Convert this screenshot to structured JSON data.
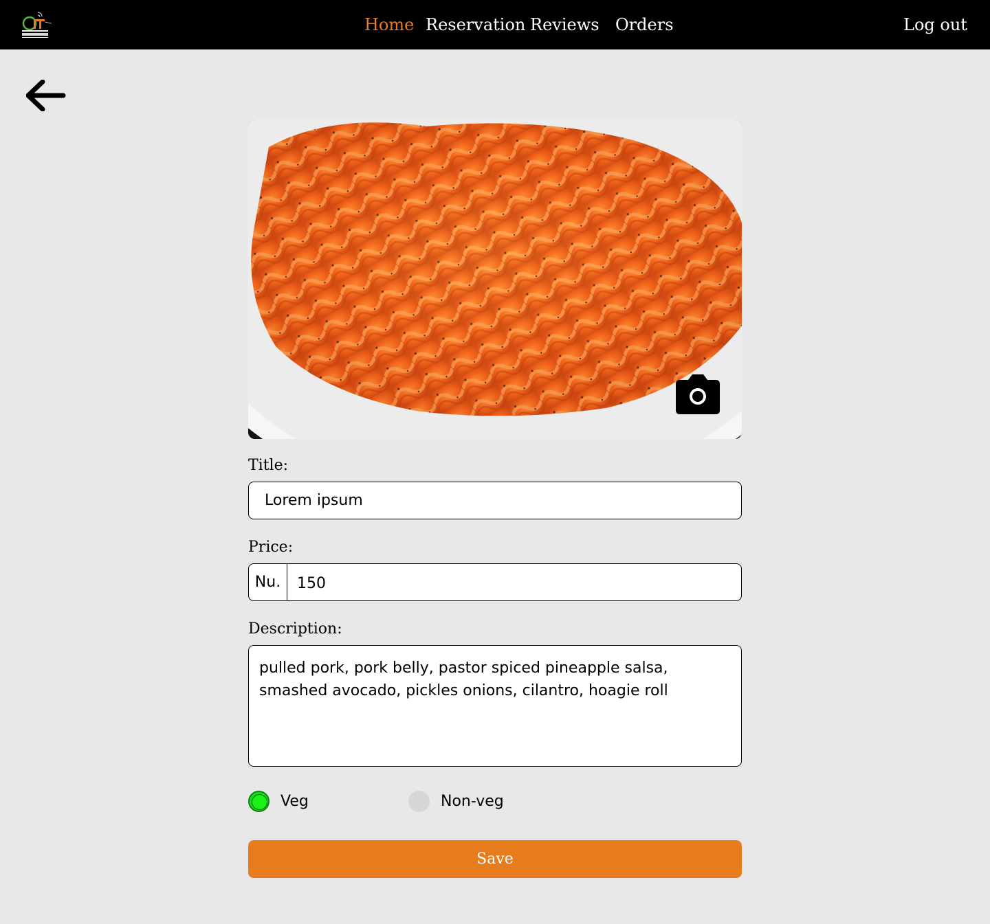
{
  "header": {
    "logo_alt": "CiT GYALPOZHING",
    "nav": [
      {
        "label": "Home",
        "active": true
      },
      {
        "label": "Reservation",
        "active": false
      },
      {
        "label": "Reviews",
        "active": false
      },
      {
        "label": "Orders",
        "active": false
      }
    ],
    "logout_label": "Log out"
  },
  "colors": {
    "accent": "#e67c24",
    "header_bg": "#000000",
    "page_bg": "#e8e8e8",
    "veg_selected": "#14e014",
    "save_button": "#e67c1c"
  },
  "form": {
    "title_label": "Title:",
    "title_value": "Lorem ipsum",
    "price_label": "Price:",
    "price_prefix": "Nu.",
    "price_value": "150",
    "description_label": "Description:",
    "description_value": "pulled pork, pork belly, pastor spiced pineapple salsa, smashed avocado, pickles onions, cilantro, hoagie roll",
    "diet_options": [
      {
        "label": "Veg",
        "selected": true
      },
      {
        "label": "Non-veg",
        "selected": false
      }
    ],
    "save_label": "Save"
  },
  "icons": {
    "back": "arrow-left-icon",
    "camera": "camera-icon"
  }
}
